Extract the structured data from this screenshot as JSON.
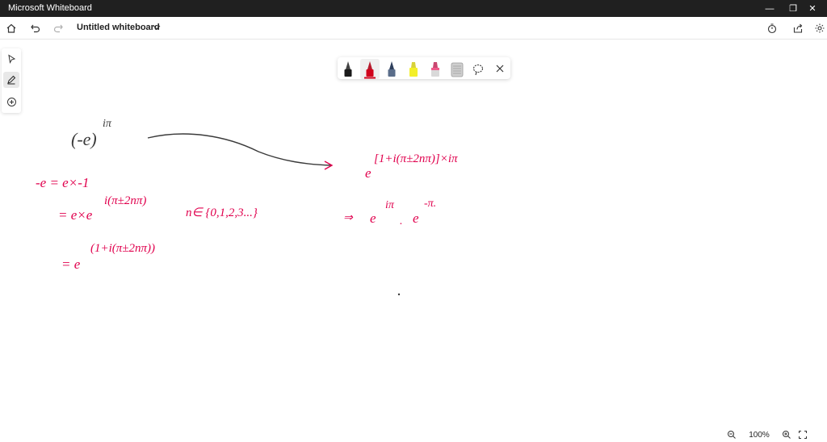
{
  "titlebar": {
    "app_title": "Microsoft Whiteboard",
    "minimize_glyph": "—",
    "maximize_glyph": "❐",
    "close_glyph": "✕"
  },
  "toolbar": {
    "doc_title": "Untitled whiteboard"
  },
  "colors": {
    "ink_black": "#3a3a3a",
    "ink_red": "#e0004d",
    "accent": "#e0004d"
  },
  "pens": [
    {
      "name": "black-pen",
      "color": "#1a1a1a"
    },
    {
      "name": "red-pen",
      "color": "#d0021b"
    },
    {
      "name": "blue-pen",
      "color": "#5a6d8a"
    },
    {
      "name": "yellow-highlighter",
      "color": "#f3ef2a"
    },
    {
      "name": "pink-highlighter",
      "color": "#ef5a8a"
    },
    {
      "name": "ruler",
      "color": "#b9b9b9"
    }
  ],
  "ink": {
    "expr_base": "(-e)",
    "expr_exp": "iπ",
    "line1": "-e = e×-1",
    "line2": "= e×e",
    "line2_exp": "i(π±2nπ)",
    "set_def": "n∈ {0,1,2,3...}",
    "line3": "= e",
    "line3_exp": "(1+i(π±2nπ))",
    "rhs_base": "e",
    "rhs_exp": "[1+i(π±2nπ)]×iπ",
    "implies": "⇒",
    "rhs2_a": "e",
    "rhs2_a_exp": "iπ",
    "dot": ".",
    "rhs2_b": "e",
    "rhs2_b_exp": "-π."
  },
  "zoom": {
    "level": "100%"
  }
}
